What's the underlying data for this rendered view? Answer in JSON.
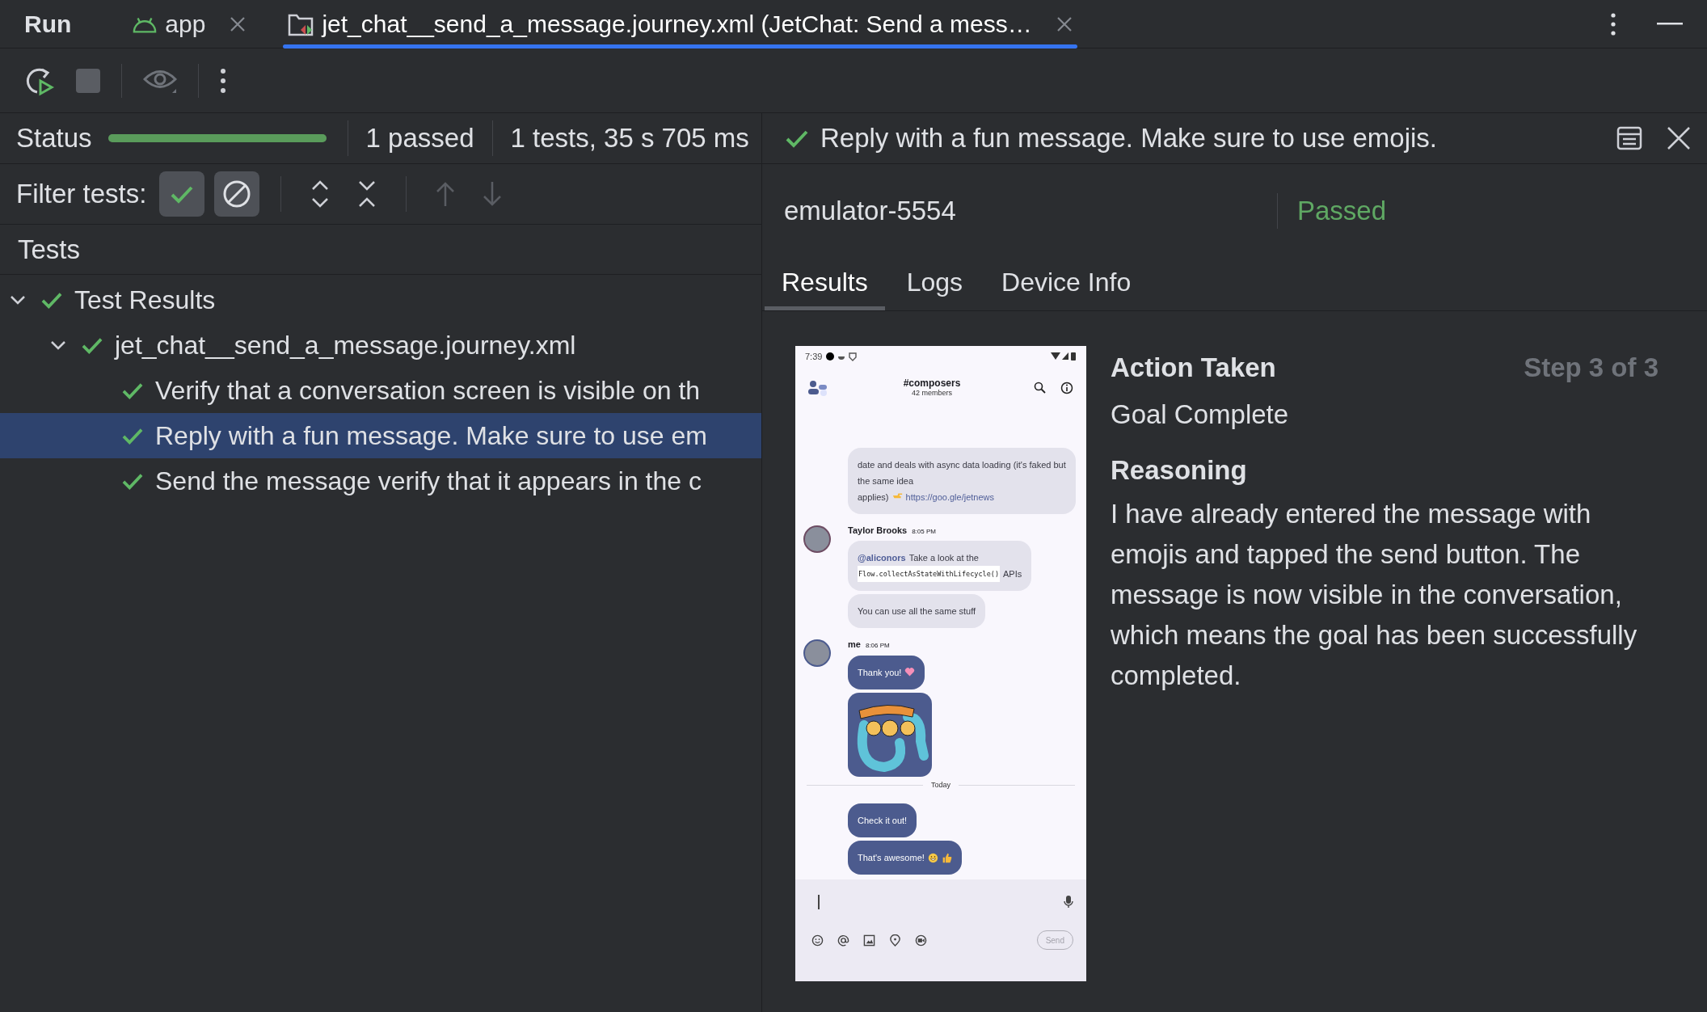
{
  "tool_window": {
    "title": "Run"
  },
  "tabs": [
    {
      "label": "app",
      "kind": "android",
      "selected": false
    },
    {
      "label": "jet_chat__send_a_message.journey.xml (JetChat: Send a mess…",
      "kind": "journey",
      "selected": true
    }
  ],
  "status": {
    "label": "Status",
    "level": 1,
    "passed": "1 passed",
    "summary": "1 tests, 35 s 705 ms"
  },
  "filter": {
    "label": "Filter tests:",
    "toggles": [
      {
        "kind": "passed",
        "on": true
      },
      {
        "kind": "ignored",
        "on": true
      }
    ]
  },
  "tests": {
    "header": "Tests",
    "tree": [
      {
        "label": "Test Results",
        "passed": true,
        "expanded": true,
        "selected": false,
        "children": [
          {
            "label": "jet_chat__send_a_message.journey.xml",
            "passed": true,
            "expanded": true,
            "selected": false,
            "children": [
              {
                "label": "Verify that a conversation screen is visible on th",
                "passed": true,
                "selected": false
              },
              {
                "label": "Reply with a fun message. Make sure to use em",
                "passed": true,
                "selected": true
              },
              {
                "label": "Send the message verify that it appears in the c",
                "passed": true,
                "selected": false
              }
            ]
          }
        ]
      }
    ]
  },
  "detail": {
    "title": "Reply with a fun message. Make sure to use emojis.",
    "passed": true,
    "device": "emulator-5554",
    "result": "Passed",
    "tabs": [
      {
        "label": "Results",
        "selected": true
      },
      {
        "label": "Logs",
        "selected": false
      },
      {
        "label": "Device Info",
        "selected": false
      }
    ],
    "action_label": "Action Taken",
    "step": "Step 3 of 3",
    "action": "Goal Complete",
    "reasoning_label": "Reasoning",
    "reasoning": "I have already entered the message with emojis and tapped the send button. The message is now visible in the conversation, which means the goal has been successfully completed."
  },
  "phone": {
    "time": "7:39",
    "channel": "#composers",
    "members": "42 members",
    "items": [
      {
        "kind": "group",
        "mine": false,
        "messages": [
          {
            "kind": "text",
            "lines": [
              [
                {
                  "kind": "text",
                  "text": "date and deals with async data loading (it's faked but the same idea"
                }
              ],
              [
                {
                  "kind": "text",
                  "text": "applies)"
                },
                {
                  "kind": "pointing_hand_emoji"
                },
                {
                  "kind": "link",
                  "text": "https://goo.gle/jetnews"
                }
              ]
            ]
          }
        ]
      },
      {
        "kind": "group",
        "mine": false,
        "author": "Taylor Brooks",
        "time": "8:05 PM",
        "messages": [
          {
            "kind": "text",
            "lines": [
              [
                {
                  "kind": "mention",
                  "text": "@aliconors"
                },
                {
                  "kind": "text",
                  "text": "Take a look at the"
                }
              ],
              [
                {
                  "kind": "code",
                  "text": "Flow.collectAsStateWithLifecycle()"
                },
                {
                  "kind": "text",
                  "text": "APIs"
                }
              ]
            ]
          },
          {
            "kind": "text",
            "lines": [
              [
                {
                  "kind": "text",
                  "text": "You can use all the same stuff"
                }
              ]
            ]
          }
        ]
      },
      {
        "kind": "group",
        "mine": true,
        "author": "me",
        "time": "8:06 PM",
        "messages": [
          {
            "kind": "text",
            "lines": [
              [
                {
                  "kind": "text",
                  "text": "Thank you!"
                },
                {
                  "kind": "heart_emoji"
                }
              ]
            ]
          },
          {
            "kind": "sticker"
          }
        ]
      },
      {
        "kind": "divider",
        "text": "Today"
      },
      {
        "kind": "group",
        "mine": true,
        "messages": [
          {
            "kind": "text",
            "lines": [
              [
                {
                  "kind": "text",
                  "text": "Check it out!"
                }
              ]
            ]
          },
          {
            "kind": "text",
            "lines": [
              [
                {
                  "kind": "text",
                  "text": "That's awesome!"
                },
                {
                  "kind": "grin_emoji"
                },
                {
                  "kind": "thumbs_up_emoji"
                }
              ]
            ]
          }
        ]
      }
    ],
    "send": "Send"
  }
}
